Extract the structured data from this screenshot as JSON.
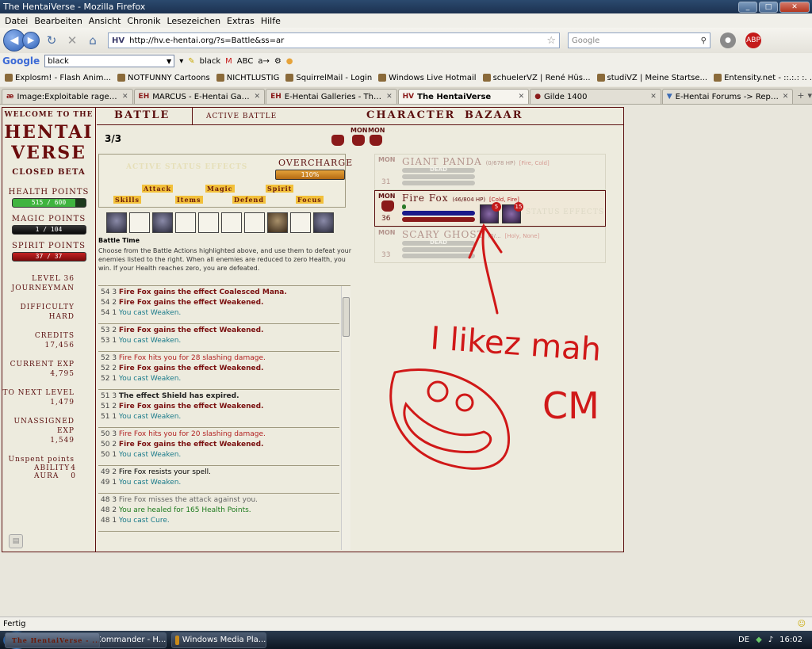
{
  "window": {
    "title": "The HentaiVerse - Mozilla Firefox"
  },
  "menu": [
    "Datei",
    "Bearbeiten",
    "Ansicht",
    "Chronik",
    "Lesezeichen",
    "Extras",
    "Hilfe"
  ],
  "nav": {
    "url": "http://hv.e-hentai.org/?s=Battle&ss=ar",
    "search_placeholder": "Google"
  },
  "googlebar": {
    "logo": "Google",
    "query": "black",
    "highlight": "black"
  },
  "bookmarks": [
    "Explosm! - Flash Anim...",
    "NOTFUNNY Cartoons",
    "NICHTLUSTIG",
    "SquirrelMail - Login",
    "Windows Live Hotmail",
    "schuelerVZ | René Hüs...",
    "studiVZ | Meine Startse...",
    "Entensity.net - ::.:.: :. ..."
  ],
  "tabs": [
    {
      "icon": "æ",
      "label": "Image:Exploitable rage.jpg ...",
      "active": false
    },
    {
      "icon": "EH",
      "label": "MARCUS - E-Hentai Galleries",
      "active": false
    },
    {
      "icon": "EH",
      "label": "E-Hentai Galleries - The Fre...",
      "active": false
    },
    {
      "icon": "HV",
      "label": "The HentaiVerse",
      "active": true
    },
    {
      "icon": "",
      "label": "Gilde 1400",
      "active": false
    },
    {
      "icon": "",
      "label": "E-Hentai Forums -> Replyi...",
      "active": false
    }
  ],
  "sidebar": {
    "welcome": "Welcome to the",
    "logo1": "HENTAI",
    "logo2": "VERSE",
    "beta": "Closed Beta",
    "hp_label": "Health Points",
    "hp": "515 / 600",
    "hp_frac": 0.858,
    "mp_label": "Magic Points",
    "mp": "1 / 104",
    "mp_frac": 0.01,
    "sp_label": "Spirit Points",
    "sp": "37 / 37",
    "sp_frac": 1.0,
    "level_label": "Level 36",
    "class": "Journeyman",
    "difficulty_label": "Difficulty",
    "difficulty": "Hard",
    "credits_label": "Credits",
    "credits": "17,456",
    "exp_label": "Current EXP",
    "exp": "4,795",
    "next_label": "To next level",
    "next": "1,479",
    "unassigned_label": "Unassigned EXP",
    "unassigned": "1,549",
    "unspent_label": "Unspent points",
    "ability_label": "Ability",
    "ability": "4",
    "aura_label": "Aura",
    "aura": "0"
  },
  "topnav": {
    "battle": "Battle",
    "active_battle": "Active Battle",
    "character": "Character",
    "bazaar": "Bazaar"
  },
  "battle": {
    "round": "3/3",
    "mon_label": "MON",
    "active_status": "Active Status Effects",
    "overcharge_label": "Overcharge",
    "overcharge": "110%",
    "actions": {
      "attack": "Attack",
      "magic": "Magic",
      "spirit": "Spirit",
      "skills": "Skills",
      "items": "Items",
      "defend": "Defend",
      "focus": "Focus"
    },
    "battle_time": "Battle Time",
    "description": "Choose from the Battle Actions highlighted above, and use them to defeat your enemies listed to the right. When all enemies are reduced to zero Health, you win. If your Health reaches zero, you are defeated."
  },
  "log": [
    [
      {
        "n": "54 3",
        "t": "Fire Fox gains the effect Coalesced Mana.",
        "c": "c-bold"
      },
      {
        "n": "54 2",
        "t": "Fire Fox gains the effect Weakened.",
        "c": "c-bold"
      },
      {
        "n": "54 1",
        "t": "You cast Weaken.",
        "c": "c-teal"
      }
    ],
    [
      {
        "n": "53 2",
        "t": "Fire Fox gains the effect Weakened.",
        "c": "c-bold"
      },
      {
        "n": "53 1",
        "t": "You cast Weaken.",
        "c": "c-teal"
      }
    ],
    [
      {
        "n": "52 3",
        "t": "Fire Fox hits you for 28 slashing damage.",
        "c": "c-red"
      },
      {
        "n": "52 2",
        "t": "Fire Fox gains the effect Weakened.",
        "c": "c-bold"
      },
      {
        "n": "52 1",
        "t": "You cast Weaken.",
        "c": "c-teal"
      }
    ],
    [
      {
        "n": "51 3",
        "t": "The effect Shield has expired.",
        "c": "c-black"
      },
      {
        "n": "51 2",
        "t": "Fire Fox gains the effect Weakened.",
        "c": "c-bold"
      },
      {
        "n": "51 1",
        "t": "You cast Weaken.",
        "c": "c-teal"
      }
    ],
    [
      {
        "n": "50 3",
        "t": "Fire Fox hits you for 20 slashing damage.",
        "c": "c-red"
      },
      {
        "n": "50 2",
        "t": "Fire Fox gains the effect Weakened.",
        "c": "c-bold"
      },
      {
        "n": "50 1",
        "t": "You cast Weaken.",
        "c": "c-teal"
      }
    ],
    [
      {
        "n": "49 2",
        "t": "Fire Fox resists your spell.",
        "c": ""
      },
      {
        "n": "49 1",
        "t": "You cast Weaken.",
        "c": "c-teal"
      }
    ],
    [
      {
        "n": "48 3",
        "t": "Fire Fox misses the attack against you.",
        "c": "c-gray"
      },
      {
        "n": "48 2",
        "t": "You are healed for 165 Health Points.",
        "c": "c-green"
      },
      {
        "n": "48 1",
        "t": "You cast Cure.",
        "c": "c-teal"
      }
    ]
  ],
  "monsters": [
    {
      "label": "MON",
      "level": "31",
      "name": "Giant Panda",
      "hp": "(0/678 HP)",
      "elem": "[Fire, Cold]",
      "dead": true,
      "dead_label": "DEAD",
      "effects": []
    },
    {
      "label": "MON",
      "level": "36",
      "name": "Fire Fox",
      "hp": "(46/804 HP)",
      "elem": "[Cold, Fire]",
      "dead": false,
      "dead_label": "",
      "effects": [
        "5",
        "15"
      ],
      "status_text": "Status Effects"
    },
    {
      "label": "MON",
      "level": "33",
      "name": "Scary Ghost",
      "hp": "(0/...",
      "elem": "[Holy, None]",
      "dead": true,
      "dead_label": "DEAD",
      "effects": []
    }
  ],
  "drawing": {
    "text1": "I likez mah",
    "text2": "CM"
  },
  "status": {
    "text": "Fertig"
  },
  "taskbar": {
    "items": [
      "The HentaiVerse - ...",
      "KeyCommander - H...",
      "Windows Media Pla..."
    ],
    "lang": "DE",
    "clock": "16:02"
  },
  "colors": {
    "accent": "#5c1010",
    "ink": "#d01818",
    "hp": "#157815",
    "sp": "#7a0a0a",
    "overcharge": "#e6a33a"
  }
}
